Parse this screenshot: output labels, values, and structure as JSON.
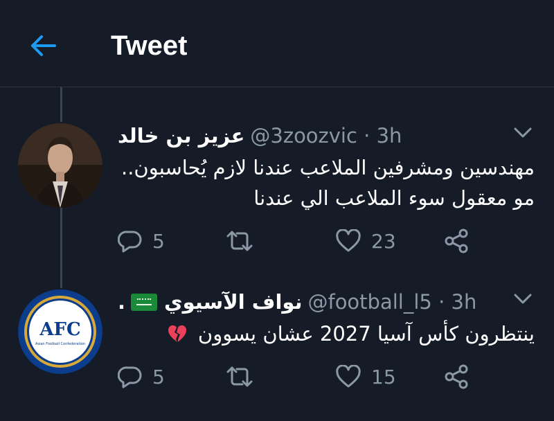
{
  "header": {
    "title": "Tweet"
  },
  "tweets": [
    {
      "display_name": "عزيز بن خالد",
      "handle": "@3zoozvic",
      "time": "3h",
      "lines": [
        "مهندسين ومشرفين الملاعب عندنا لازم يُحاسبون..",
        "مو معقول سوء الملاعب الي عندنا"
      ],
      "replies": "5",
      "retweets": "",
      "likes": "23"
    },
    {
      "display_name": "نواف الآسيوي",
      "flag": "saudi-flag",
      "dot": ".",
      "handle": "@football_l5",
      "time": "3h",
      "lines": [
        "ينتظرون كأس آسيا 2027 عشان يسوون"
      ],
      "emoji": "broken-heart",
      "replies": "5",
      "retweets": "",
      "likes": "15",
      "avatar_text": "AFC",
      "avatar_subtext": "Asian Football Confederation"
    }
  ],
  "colors": {
    "background": "#151c27",
    "accent": "#1d9bf0",
    "muted": "#8b98a6",
    "divider": "#2a3442"
  }
}
